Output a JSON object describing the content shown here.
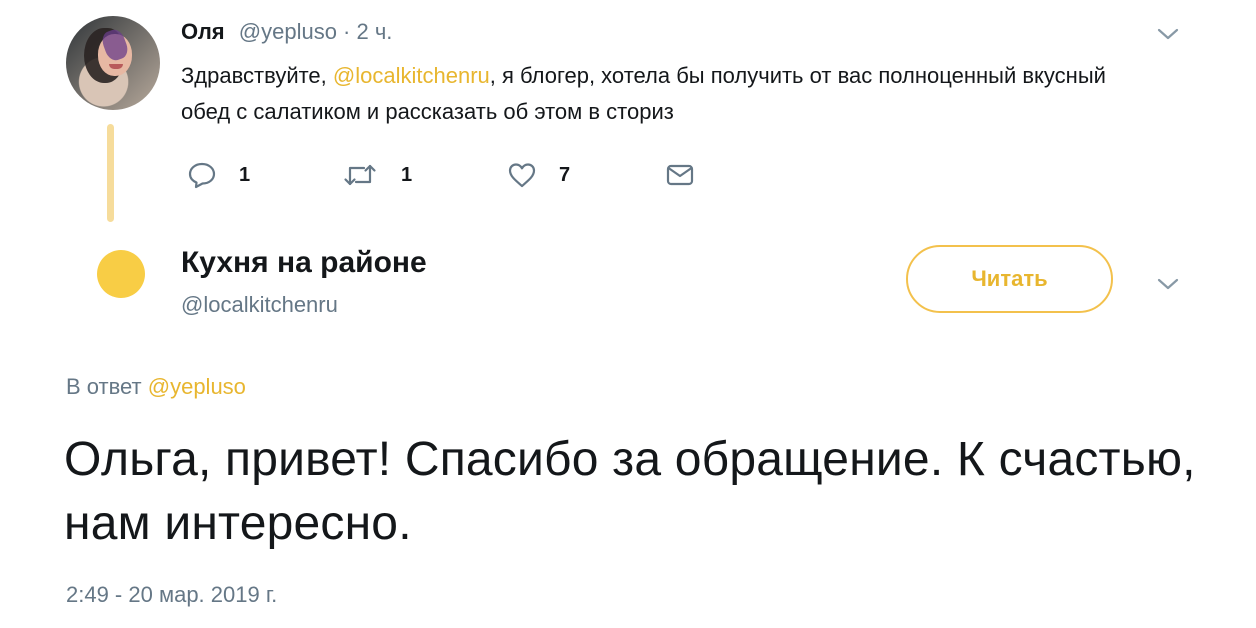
{
  "tweet": {
    "author_name": "Оля",
    "author_handle": "@yepluso",
    "separator": " · ",
    "time_ago": "2 ч.",
    "text_part1": "Здравствуйте, ",
    "mention": "@localkitchenru",
    "text_part2": ", я блогер, хотела бы получить от вас полноценный вкусный обед с салатиком и рассказать об этом в сториз",
    "actions": {
      "reply_count": "1",
      "retweet_count": "1",
      "like_count": "7"
    }
  },
  "account": {
    "name": "Кухня на районе",
    "handle": "@localkitchenru",
    "follow_label": "Читать",
    "avatar_color": "#f8cd45"
  },
  "reply": {
    "reply_prefix": "В ответ ",
    "reply_handle": "@yepluso",
    "text": "Ольга, привет! Спасибо за обращение. К счастью, нам интересно.",
    "timestamp": "2:49 - 20 мар. 2019 г."
  },
  "colors": {
    "accent": "#e8b62f",
    "muted": "#657786",
    "thread_line": "#f6dc9b"
  }
}
